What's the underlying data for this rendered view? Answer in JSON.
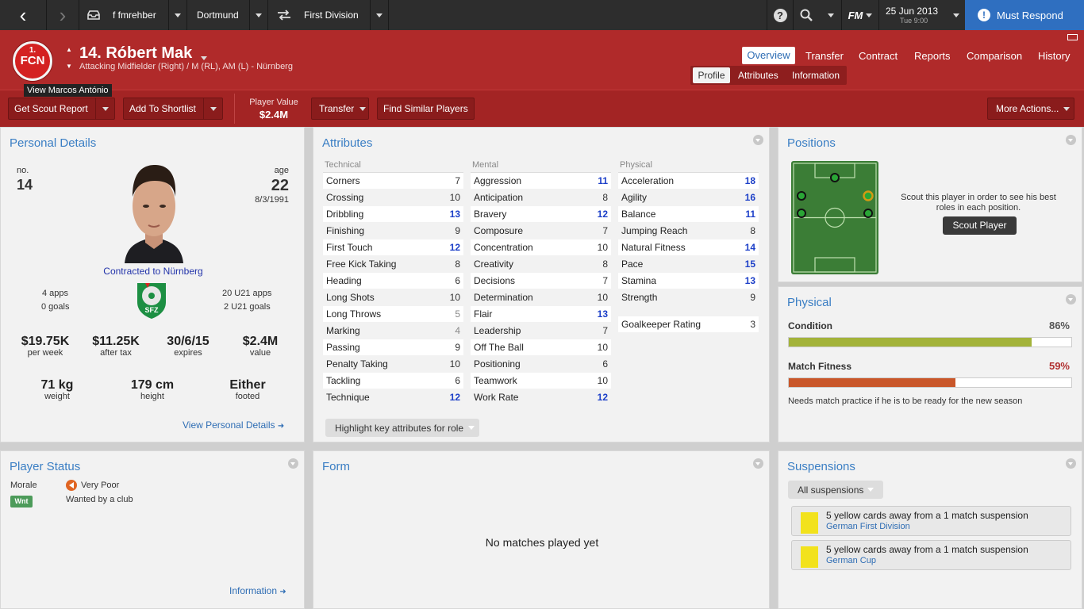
{
  "topbar": {
    "back": "‹",
    "forward": "›",
    "manager": "f fmrehber",
    "club": "Dortmund",
    "competition": "First Division",
    "logo": "FM",
    "date": "25 Jun 2013",
    "time": "Tue 9:00",
    "continue": "Must Respond"
  },
  "player": {
    "number_name": "14. Róbert Mak",
    "subtitle": "Attacking Midfielder (Right) / M (RL), AM (L) - Nürnberg",
    "club_badge": "FCN",
    "club_badge_num": "1.",
    "tooltip": "View Marcos António"
  },
  "tabs": {
    "main": [
      "Overview",
      "Transfer",
      "Contract",
      "Reports",
      "Comparison",
      "History"
    ],
    "sub": [
      "Profile",
      "Attributes",
      "Information"
    ]
  },
  "actions": {
    "scout_report": "Get Scout Report",
    "shortlist": "Add To Shortlist",
    "value_label": "Player Value",
    "value": "$2.4M",
    "transfer": "Transfer",
    "similar": "Find Similar Players",
    "more": "More Actions..."
  },
  "personal": {
    "title": "Personal Details",
    "no_label": "no.",
    "no": "14",
    "age_label": "age",
    "age": "22",
    "dob": "8/3/1991",
    "contract": "Contracted to Nürnberg",
    "apps": "4 apps",
    "goals": "0 goals",
    "u21_apps": "20 U21 apps",
    "u21_goals": "2 U21 goals",
    "nat_badge": "SFZ",
    "wage": "$19.75K",
    "wage_label": "per week",
    "after_tax": "$11.25K",
    "after_tax_label": "after tax",
    "expires": "30/6/15",
    "expires_label": "expires",
    "value": "$2.4M",
    "value_label": "value",
    "weight": "71 kg",
    "weight_label": "weight",
    "height": "179 cm",
    "height_label": "height",
    "foot": "Either",
    "foot_label": "footed",
    "link": "View Personal Details"
  },
  "attributes": {
    "title": "Attributes",
    "technical_label": "Technical",
    "mental_label": "Mental",
    "physical_label": "Physical",
    "technical": [
      [
        "Corners",
        "7",
        ""
      ],
      [
        "Crossing",
        "10",
        ""
      ],
      [
        "Dribbling",
        "13",
        "hi"
      ],
      [
        "Finishing",
        "9",
        ""
      ],
      [
        "First Touch",
        "12",
        "hi"
      ],
      [
        "Free Kick Taking",
        "8",
        ""
      ],
      [
        "Heading",
        "6",
        ""
      ],
      [
        "Long Shots",
        "10",
        ""
      ],
      [
        "Long Throws",
        "5",
        "lo"
      ],
      [
        "Marking",
        "4",
        "lo"
      ],
      [
        "Passing",
        "9",
        ""
      ],
      [
        "Penalty Taking",
        "10",
        ""
      ],
      [
        "Tackling",
        "6",
        ""
      ],
      [
        "Technique",
        "12",
        "hi"
      ]
    ],
    "mental": [
      [
        "Aggression",
        "11",
        "hi"
      ],
      [
        "Anticipation",
        "8",
        ""
      ],
      [
        "Bravery",
        "12",
        "hi"
      ],
      [
        "Composure",
        "7",
        ""
      ],
      [
        "Concentration",
        "10",
        ""
      ],
      [
        "Creativity",
        "8",
        ""
      ],
      [
        "Decisions",
        "7",
        ""
      ],
      [
        "Determination",
        "10",
        ""
      ],
      [
        "Flair",
        "13",
        "hi"
      ],
      [
        "Leadership",
        "7",
        ""
      ],
      [
        "Off The Ball",
        "10",
        ""
      ],
      [
        "Positioning",
        "6",
        ""
      ],
      [
        "Teamwork",
        "10",
        ""
      ],
      [
        "Work Rate",
        "12",
        "hi"
      ]
    ],
    "physical": [
      [
        "Acceleration",
        "18",
        "hi"
      ],
      [
        "Agility",
        "16",
        "hi"
      ],
      [
        "Balance",
        "11",
        "hi"
      ],
      [
        "Jumping Reach",
        "8",
        ""
      ],
      [
        "Natural Fitness",
        "14",
        "hi"
      ],
      [
        "Pace",
        "15",
        "hi"
      ],
      [
        "Stamina",
        "13",
        "hi"
      ],
      [
        "Strength",
        "9",
        ""
      ]
    ],
    "gk_label": "Goalkeeper Rating",
    "gk": "3",
    "highlight": "Highlight key attributes for role"
  },
  "positions": {
    "title": "Positions",
    "text": "Scout this player in order to see his best roles in each position.",
    "button": "Scout Player"
  },
  "physical_panel": {
    "title": "Physical",
    "condition_label": "Condition",
    "condition": "86%",
    "condition_fraction": 0.86,
    "fitness_label": "Match Fitness",
    "fitness": "59%",
    "fitness_fraction": 0.59,
    "note": "Needs match practice if he is to be ready for the new season",
    "condition_color": "#a3b33a",
    "fitness_color": "#c9572a"
  },
  "status": {
    "title": "Player Status",
    "morale_label": "Morale",
    "morale": "Very Poor",
    "badge": "Wnt",
    "wanted": "Wanted by a club",
    "link": "Information"
  },
  "form": {
    "title": "Form",
    "empty": "No matches played yet"
  },
  "suspensions": {
    "title": "Suspensions",
    "filter": "All suspensions",
    "items": [
      {
        "text": "5 yellow cards away from a 1 match suspension",
        "comp": "German First Division"
      },
      {
        "text": "5 yellow cards away from a 1 match suspension",
        "comp": "German Cup"
      }
    ]
  }
}
